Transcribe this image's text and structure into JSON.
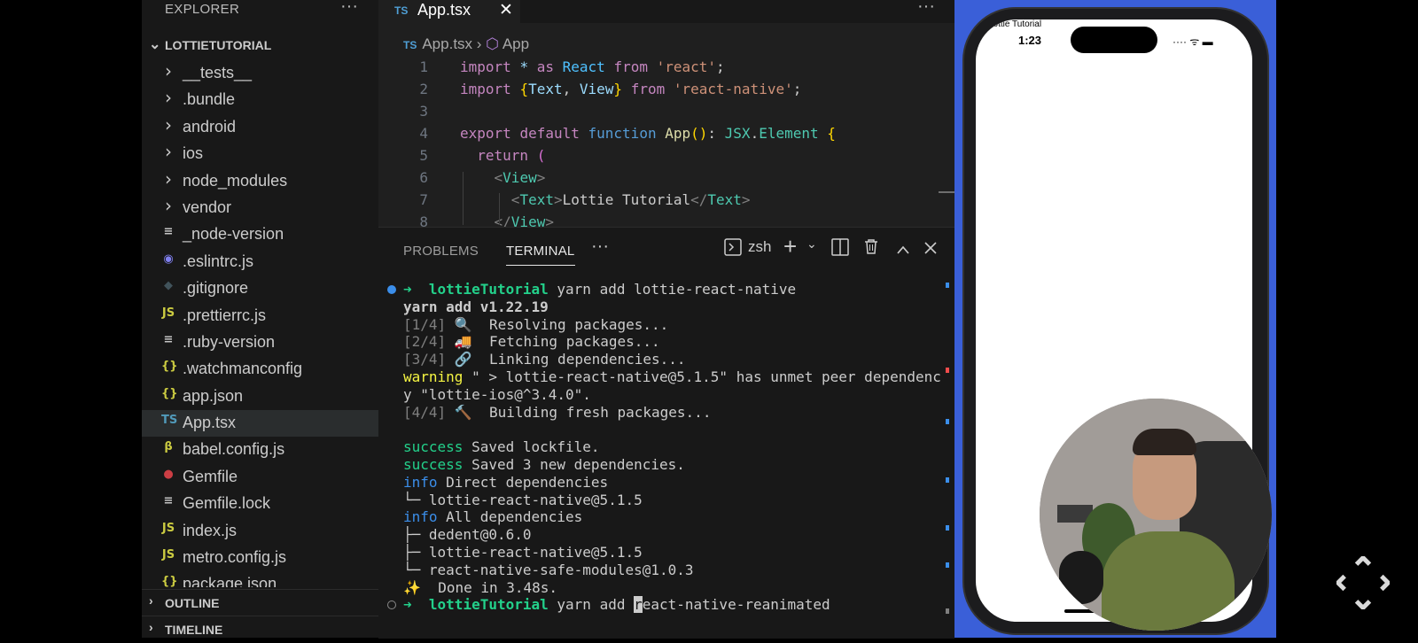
{
  "sidebar": {
    "header": "EXPLORER",
    "more_icon": "···",
    "project": "LOTTIETUTORIAL",
    "items": [
      {
        "label": "__tests__",
        "kind": "folder"
      },
      {
        "label": ".bundle",
        "kind": "folder"
      },
      {
        "label": "android",
        "kind": "folder"
      },
      {
        "label": "ios",
        "kind": "folder"
      },
      {
        "label": "node_modules",
        "kind": "folder"
      },
      {
        "label": "vendor",
        "kind": "folder"
      },
      {
        "label": "_node-version",
        "kind": "lines",
        "icon": "≡",
        "color": "#c5c5c5"
      },
      {
        "label": ".eslintrc.js",
        "kind": "eslint",
        "icon": "◉",
        "color": "#8080f0"
      },
      {
        "label": ".gitignore",
        "kind": "git",
        "icon": "◆",
        "color": "#41535b"
      },
      {
        "label": ".prettierrc.js",
        "kind": "js",
        "icon": "JS",
        "color": "#cbcb41"
      },
      {
        "label": ".ruby-version",
        "kind": "lines",
        "icon": "≡",
        "color": "#c5c5c5"
      },
      {
        "label": ".watchmanconfig",
        "kind": "json",
        "icon": "{}",
        "color": "#cbcb41"
      },
      {
        "label": "app.json",
        "kind": "json",
        "icon": "{}",
        "color": "#cbcb41"
      },
      {
        "label": "App.tsx",
        "kind": "ts",
        "icon": "TS",
        "color": "#519aba",
        "selected": true
      },
      {
        "label": "babel.config.js",
        "kind": "babel",
        "icon": "β",
        "color": "#cbcb41"
      },
      {
        "label": "Gemfile",
        "kind": "ruby",
        "icon": "●",
        "color": "#cc3e44"
      },
      {
        "label": "Gemfile.lock",
        "kind": "lines",
        "icon": "≡",
        "color": "#c5c5c5"
      },
      {
        "label": "index.js",
        "kind": "js",
        "icon": "JS",
        "color": "#cbcb41"
      },
      {
        "label": "metro.config.js",
        "kind": "js",
        "icon": "JS",
        "color": "#cbcb41"
      },
      {
        "label": "package.json",
        "kind": "json",
        "icon": "{}",
        "color": "#cbcb41"
      }
    ],
    "outline": "OUTLINE",
    "timeline": "TIMELINE"
  },
  "editor": {
    "tab": {
      "badge": "TS",
      "name": "App.tsx",
      "close": "✕"
    },
    "breadcrumb": {
      "badge": "TS",
      "file": "App.tsx",
      "symbol": "App"
    },
    "lines": [
      {
        "n": "1",
        "html": "<span style=\"color:#c586c0\">import</span> <span style=\"color:#9cdcfe\">*</span> <span style=\"color:#c586c0\">as</span> <span style=\"color:#4fc1ff\">React</span> <span style=\"color:#c586c0\">from</span> <span style=\"color:#ce9178\">'react'</span>;"
      },
      {
        "n": "2",
        "html": "<span style=\"color:#c586c0\">import</span> <span style=\"color:#ffd700\">{</span><span style=\"color:#9cdcfe\">Text</span>, <span style=\"color:#9cdcfe\">View</span><span style=\"color:#ffd700\">}</span> <span style=\"color:#c586c0\">from</span> <span style=\"color:#ce9178\">'react-native'</span>;"
      },
      {
        "n": "3",
        "html": ""
      },
      {
        "n": "4",
        "html": "<span style=\"color:#c586c0\">export</span> <span style=\"color:#c586c0\">default</span> <span style=\"color:#569cd6\">function</span> <span style=\"color:#dcdcaa\">App</span><span style=\"color:#ffd700\">()</span>: <span style=\"color:#4ec9b0\">JSX</span>.<span style=\"color:#4ec9b0\">Element</span> <span style=\"color:#ffd700\">{</span>"
      },
      {
        "n": "5",
        "html": "  <span style=\"color:#c586c0\">return</span> <span style=\"color:#da70d6\">(</span>"
      },
      {
        "n": "6",
        "html": "    <span style=\"color:#808080\">&lt;</span><span style=\"color:#4ec9b0\">View</span><span style=\"color:#808080\">&gt;</span>"
      },
      {
        "n": "7",
        "html": "      <span style=\"color:#808080\">&lt;</span><span style=\"color:#4ec9b0\">Text</span><span style=\"color:#808080\">&gt;</span>Lottie Tutorial<span style=\"color:#808080\">&lt;/</span><span style=\"color:#4ec9b0\">Text</span><span style=\"color:#808080\">&gt;</span>"
      },
      {
        "n": "8",
        "html": "    <span style=\"color:#808080\">&lt;/</span><span style=\"color:#4ec9b0\">View</span><span style=\"color:#808080\">&gt;</span>"
      }
    ]
  },
  "panel": {
    "tabs": [
      "PROBLEMS",
      "TERMINAL"
    ],
    "active_tab": "TERMINAL",
    "shell": "zsh",
    "terminal_lines": [
      {
        "html": "<span class=\"g bold\">➜</span>  <span class=\"g bold\">lottieTutorial</span> yarn add lottie-react-native",
        "dot": "#3b8eea"
      },
      {
        "html": "<span class=\"bold\">yarn add v1.22.19</span>"
      },
      {
        "html": "<span class=\"gray\">[1/4]</span> 🔍  Resolving packages..."
      },
      {
        "html": "<span class=\"gray\">[2/4]</span> 🚚  Fetching packages..."
      },
      {
        "html": "<span class=\"gray\">[3/4]</span> 🔗  Linking dependencies..."
      },
      {
        "html": "<span class=\"y\">warning</span> \" &gt; lottie-react-native@5.1.5\" has unmet peer dependenc"
      },
      {
        "html": "y \"lottie-ios@^3.4.0\"."
      },
      {
        "html": "<span class=\"gray\">[4/4]</span> 🔨  Building fresh packages..."
      },
      {
        "html": ""
      },
      {
        "html": "<span class=\"g\">success</span> Saved lockfile."
      },
      {
        "html": "<span class=\"g\">success</span> Saved 3 new dependencies."
      },
      {
        "html": "<span class=\"b\">info</span> Direct dependencies"
      },
      {
        "html": "└─ lottie-react-native@5.1.5"
      },
      {
        "html": "<span class=\"b\">info</span> All dependencies"
      },
      {
        "html": "├─ dedent@0.6.0"
      },
      {
        "html": "├─ lottie-react-native@5.1.5"
      },
      {
        "html": "└─ react-native-safe-modules@1.0.3"
      },
      {
        "html": "✨  Done in 3.48s."
      },
      {
        "html": "<span class=\"g bold\">➜</span>  <span class=\"g bold\">lottieTutorial</span> yarn add <span class=\"cursor\">r</span>eact-native-reanimated",
        "dot": "hollow"
      }
    ]
  },
  "phone": {
    "app_title": "Lottie Tutorial",
    "time": "1:23",
    "status": "···· ᯤ ▬"
  },
  "colors": {
    "sidebar_bg": "#181818",
    "editor_bg": "#1f1f1f",
    "phone_backdrop": "#3a5fd8"
  }
}
